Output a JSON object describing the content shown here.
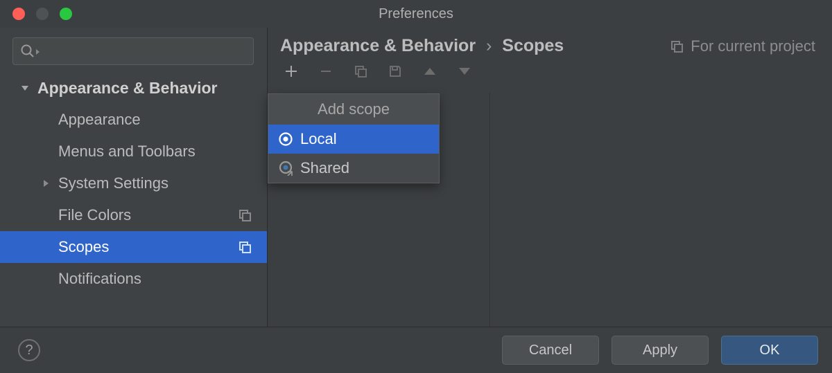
{
  "window": {
    "title": "Preferences"
  },
  "sidebar": {
    "group": "Appearance & Behavior",
    "items": [
      {
        "label": "Appearance"
      },
      {
        "label": "Menus and Toolbars"
      },
      {
        "label": "System Settings"
      },
      {
        "label": "File Colors"
      },
      {
        "label": "Scopes"
      },
      {
        "label": "Notifications"
      }
    ]
  },
  "breadcrumb": {
    "parent": "Appearance & Behavior",
    "current": "Scopes"
  },
  "for_project": "For current project",
  "popup": {
    "title": "Add scope",
    "items": [
      {
        "label": "Local"
      },
      {
        "label": "Shared"
      }
    ]
  },
  "footer": {
    "cancel": "Cancel",
    "apply": "Apply",
    "ok": "OK"
  }
}
